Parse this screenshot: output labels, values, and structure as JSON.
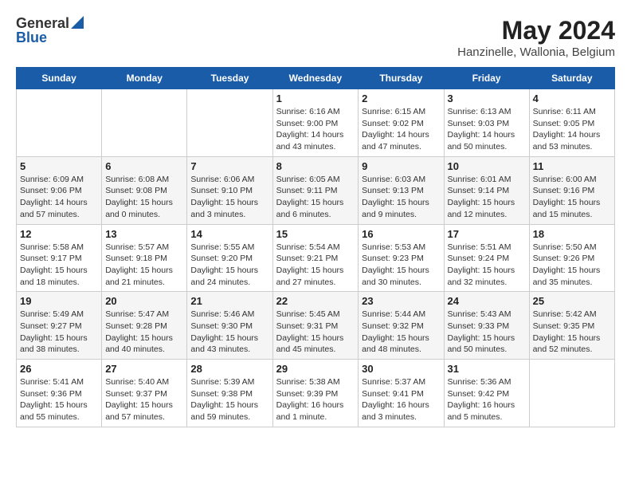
{
  "header": {
    "logo_general": "General",
    "logo_blue": "Blue",
    "title": "May 2024",
    "location": "Hanzinelle, Wallonia, Belgium"
  },
  "days_of_week": [
    "Sunday",
    "Monday",
    "Tuesday",
    "Wednesday",
    "Thursday",
    "Friday",
    "Saturday"
  ],
  "weeks": [
    [
      {
        "day": "",
        "info": ""
      },
      {
        "day": "",
        "info": ""
      },
      {
        "day": "",
        "info": ""
      },
      {
        "day": "1",
        "info": "Sunrise: 6:16 AM\nSunset: 9:00 PM\nDaylight: 14 hours\nand 43 minutes."
      },
      {
        "day": "2",
        "info": "Sunrise: 6:15 AM\nSunset: 9:02 PM\nDaylight: 14 hours\nand 47 minutes."
      },
      {
        "day": "3",
        "info": "Sunrise: 6:13 AM\nSunset: 9:03 PM\nDaylight: 14 hours\nand 50 minutes."
      },
      {
        "day": "4",
        "info": "Sunrise: 6:11 AM\nSunset: 9:05 PM\nDaylight: 14 hours\nand 53 minutes."
      }
    ],
    [
      {
        "day": "5",
        "info": "Sunrise: 6:09 AM\nSunset: 9:06 PM\nDaylight: 14 hours\nand 57 minutes."
      },
      {
        "day": "6",
        "info": "Sunrise: 6:08 AM\nSunset: 9:08 PM\nDaylight: 15 hours\nand 0 minutes."
      },
      {
        "day": "7",
        "info": "Sunrise: 6:06 AM\nSunset: 9:10 PM\nDaylight: 15 hours\nand 3 minutes."
      },
      {
        "day": "8",
        "info": "Sunrise: 6:05 AM\nSunset: 9:11 PM\nDaylight: 15 hours\nand 6 minutes."
      },
      {
        "day": "9",
        "info": "Sunrise: 6:03 AM\nSunset: 9:13 PM\nDaylight: 15 hours\nand 9 minutes."
      },
      {
        "day": "10",
        "info": "Sunrise: 6:01 AM\nSunset: 9:14 PM\nDaylight: 15 hours\nand 12 minutes."
      },
      {
        "day": "11",
        "info": "Sunrise: 6:00 AM\nSunset: 9:16 PM\nDaylight: 15 hours\nand 15 minutes."
      }
    ],
    [
      {
        "day": "12",
        "info": "Sunrise: 5:58 AM\nSunset: 9:17 PM\nDaylight: 15 hours\nand 18 minutes."
      },
      {
        "day": "13",
        "info": "Sunrise: 5:57 AM\nSunset: 9:18 PM\nDaylight: 15 hours\nand 21 minutes."
      },
      {
        "day": "14",
        "info": "Sunrise: 5:55 AM\nSunset: 9:20 PM\nDaylight: 15 hours\nand 24 minutes."
      },
      {
        "day": "15",
        "info": "Sunrise: 5:54 AM\nSunset: 9:21 PM\nDaylight: 15 hours\nand 27 minutes."
      },
      {
        "day": "16",
        "info": "Sunrise: 5:53 AM\nSunset: 9:23 PM\nDaylight: 15 hours\nand 30 minutes."
      },
      {
        "day": "17",
        "info": "Sunrise: 5:51 AM\nSunset: 9:24 PM\nDaylight: 15 hours\nand 32 minutes."
      },
      {
        "day": "18",
        "info": "Sunrise: 5:50 AM\nSunset: 9:26 PM\nDaylight: 15 hours\nand 35 minutes."
      }
    ],
    [
      {
        "day": "19",
        "info": "Sunrise: 5:49 AM\nSunset: 9:27 PM\nDaylight: 15 hours\nand 38 minutes."
      },
      {
        "day": "20",
        "info": "Sunrise: 5:47 AM\nSunset: 9:28 PM\nDaylight: 15 hours\nand 40 minutes."
      },
      {
        "day": "21",
        "info": "Sunrise: 5:46 AM\nSunset: 9:30 PM\nDaylight: 15 hours\nand 43 minutes."
      },
      {
        "day": "22",
        "info": "Sunrise: 5:45 AM\nSunset: 9:31 PM\nDaylight: 15 hours\nand 45 minutes."
      },
      {
        "day": "23",
        "info": "Sunrise: 5:44 AM\nSunset: 9:32 PM\nDaylight: 15 hours\nand 48 minutes."
      },
      {
        "day": "24",
        "info": "Sunrise: 5:43 AM\nSunset: 9:33 PM\nDaylight: 15 hours\nand 50 minutes."
      },
      {
        "day": "25",
        "info": "Sunrise: 5:42 AM\nSunset: 9:35 PM\nDaylight: 15 hours\nand 52 minutes."
      }
    ],
    [
      {
        "day": "26",
        "info": "Sunrise: 5:41 AM\nSunset: 9:36 PM\nDaylight: 15 hours\nand 55 minutes."
      },
      {
        "day": "27",
        "info": "Sunrise: 5:40 AM\nSunset: 9:37 PM\nDaylight: 15 hours\nand 57 minutes."
      },
      {
        "day": "28",
        "info": "Sunrise: 5:39 AM\nSunset: 9:38 PM\nDaylight: 15 hours\nand 59 minutes."
      },
      {
        "day": "29",
        "info": "Sunrise: 5:38 AM\nSunset: 9:39 PM\nDaylight: 16 hours\nand 1 minute."
      },
      {
        "day": "30",
        "info": "Sunrise: 5:37 AM\nSunset: 9:41 PM\nDaylight: 16 hours\nand 3 minutes."
      },
      {
        "day": "31",
        "info": "Sunrise: 5:36 AM\nSunset: 9:42 PM\nDaylight: 16 hours\nand 5 minutes."
      },
      {
        "day": "",
        "info": ""
      }
    ]
  ]
}
